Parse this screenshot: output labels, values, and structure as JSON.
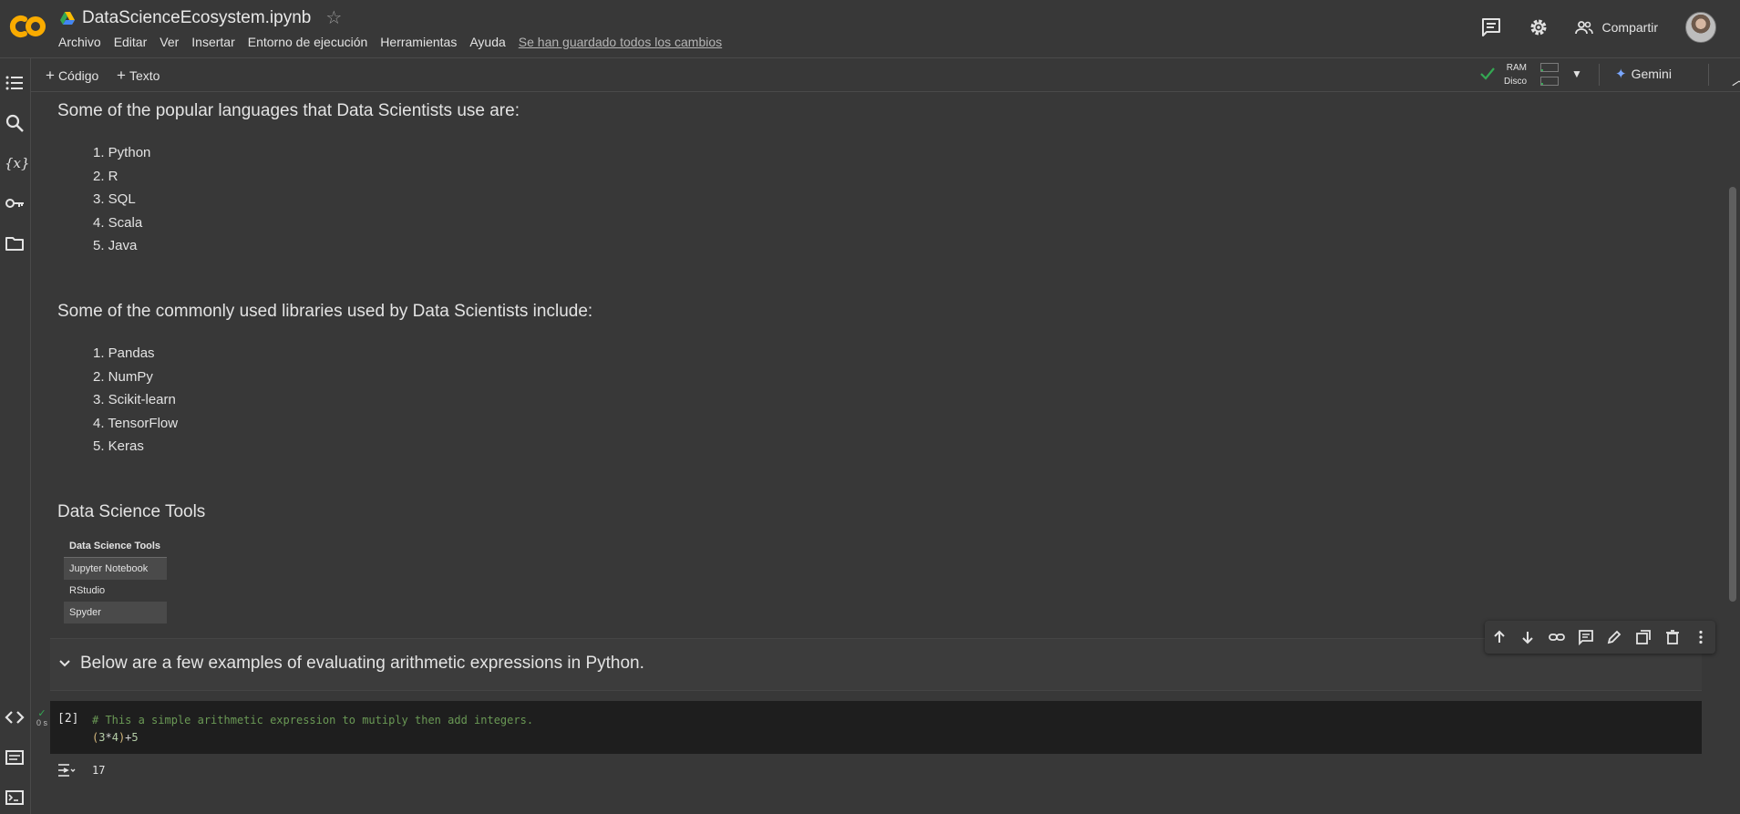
{
  "app": {
    "doc_title": "DataScienceEcosystem.ipynb",
    "menu": [
      "Archivo",
      "Editar",
      "Ver",
      "Insertar",
      "Entorno de ejecución",
      "Herramientas",
      "Ayuda"
    ],
    "saved_status": "Se han guardado todos los cambios",
    "share_label": "Compartir",
    "brand_color": "#f9ab00"
  },
  "toolbar": {
    "add_code_label": "Código",
    "add_text_label": "Texto",
    "ram_label": "RAM",
    "disk_label": "Disco",
    "gemini_label": "Gemini",
    "ram_usage_fraction": 0.1,
    "disk_usage_fraction": 0.1
  },
  "notebook": {
    "languages_heading": "Some of the popular languages that Data Scientists use are:",
    "languages": [
      "1. Python",
      "2. R",
      "3. SQL",
      "4. Scala",
      "5. Java"
    ],
    "libraries_heading": "Some of the commonly used libraries used by Data Scientists include:",
    "libraries": [
      "1. Pandas",
      "2. NumPy",
      "3. Scikit-learn",
      "4. TensorFlow",
      "5. Keras"
    ],
    "tools_heading": "Data Science Tools",
    "tools_table": {
      "header": "Data Science Tools",
      "rows": [
        "Jupyter Notebook",
        "RStudio",
        "Spyder"
      ]
    },
    "arith_heading": "Below are a few examples of evaluating arithmetic expressions in Python.",
    "code_cell": {
      "exec_count": "[2]",
      "exec_time": "0 s",
      "comment": "# This a simple arithmetic expression to mutiply then add integers.",
      "code_paren_open": "(",
      "code_a": "3",
      "code_op1": "*",
      "code_b": "4",
      "code_paren_close": ")",
      "code_op2": "+",
      "code_c": "5",
      "output": "17"
    }
  }
}
